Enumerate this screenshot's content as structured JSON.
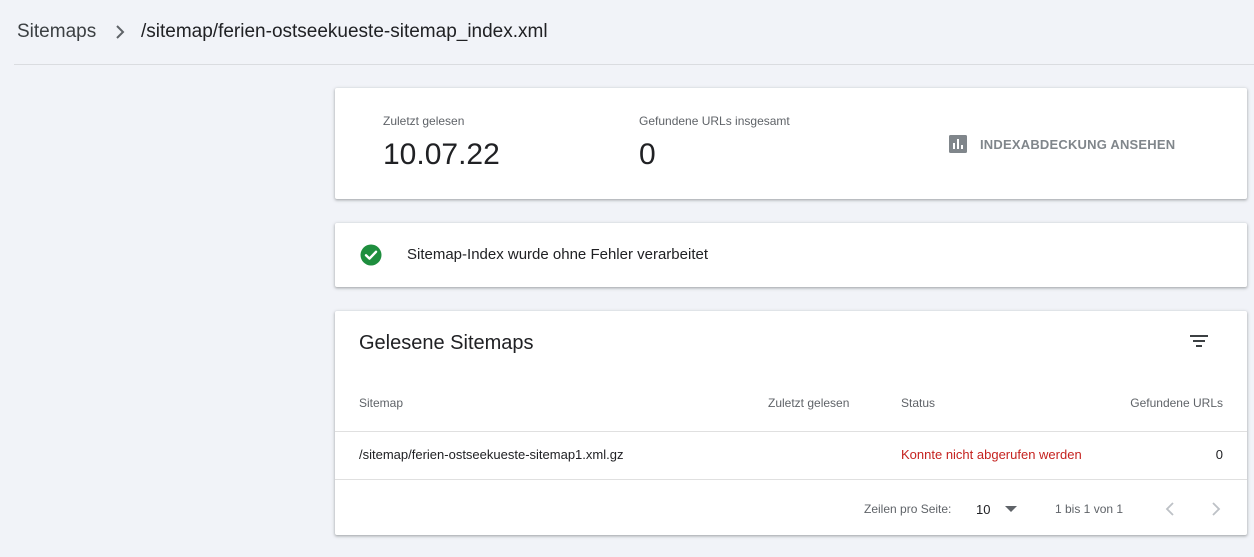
{
  "breadcrumb": {
    "root": "Sitemaps",
    "current": "/sitemap/ferien-ostseekueste-sitemap_index.xml"
  },
  "stats": {
    "last_read_label": "Zuletzt gelesen",
    "last_read_value": "10.07.22",
    "found_urls_label": "Gefundene URLs insgesamt",
    "found_urls_value": "0",
    "index_coverage_link": "INDEXABDECKUNG ANSEHEN"
  },
  "status": {
    "message": "Sitemap-Index wurde ohne Fehler verarbeitet",
    "color": "#1e8e3e"
  },
  "table": {
    "title": "Gelesene Sitemaps",
    "columns": [
      "Sitemap",
      "Zuletzt gelesen",
      "Status",
      "Gefundene URLs"
    ],
    "rows": [
      {
        "sitemap": "/sitemap/ferien-ostseekueste-sitemap1.xml.gz",
        "last_read": "",
        "status": "Konnte nicht abgerufen werden",
        "found_urls": "0"
      }
    ],
    "error_color": "#c5221f"
  },
  "pagination": {
    "rows_per_page_label": "Zeilen pro Seite:",
    "rows_per_page_value": "10",
    "range": "1 bis 1 von 1"
  },
  "icons": {
    "separator": "chevron-right-icon",
    "coverage": "bar-chart-icon",
    "status": "check-circle-icon",
    "filter": "filter-icon",
    "prev": "chevron-left-icon",
    "next": "chevron-right-icon",
    "dropdown": "dropdown-arrow-icon"
  }
}
